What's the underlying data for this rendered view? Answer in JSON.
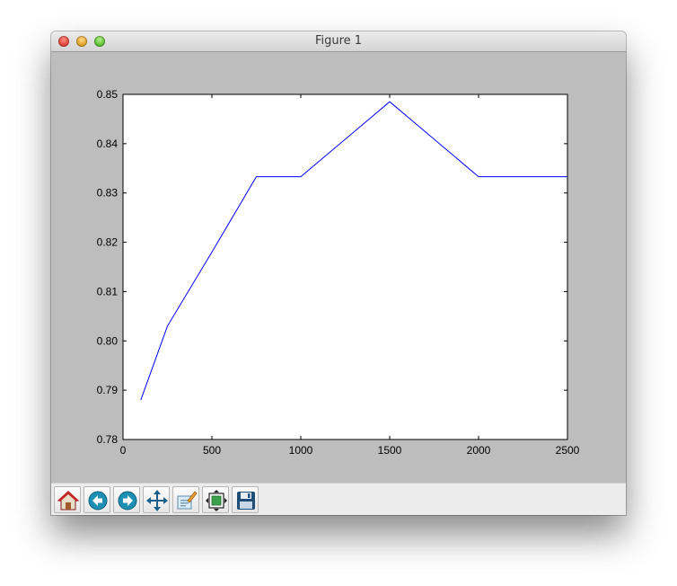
{
  "window": {
    "title": "Figure 1"
  },
  "toolbar": {
    "buttons": [
      {
        "name": "home-button",
        "icon": "home-icon"
      },
      {
        "name": "back-button",
        "icon": "back-arrow-icon"
      },
      {
        "name": "forward-button",
        "icon": "forward-arrow-icon"
      },
      {
        "name": "pan-button",
        "icon": "move-arrows-icon"
      },
      {
        "name": "zoom-button",
        "icon": "zoom-rectangle-icon"
      },
      {
        "name": "subplots-button",
        "icon": "subplots-config-icon"
      },
      {
        "name": "save-button",
        "icon": "floppy-disk-icon"
      }
    ]
  },
  "chart_data": {
    "type": "line",
    "title": "",
    "xlabel": "",
    "ylabel": "",
    "xlim": [
      0,
      2500
    ],
    "ylim": [
      0.78,
      0.85
    ],
    "xticks": [
      "0",
      "500",
      "1000",
      "1500",
      "2000",
      "2500"
    ],
    "yticks": [
      "0.78",
      "0.79",
      "0.80",
      "0.81",
      "0.82",
      "0.83",
      "0.84",
      "0.85"
    ],
    "grid": false,
    "series": [
      {
        "color": "#0000ff",
        "x": [
          100,
          250,
          500,
          750,
          1000,
          1500,
          2000,
          2500
        ],
        "y": [
          0.788,
          0.803,
          0.818,
          0.8333,
          0.8333,
          0.8485,
          0.8333,
          0.8333
        ]
      }
    ]
  }
}
